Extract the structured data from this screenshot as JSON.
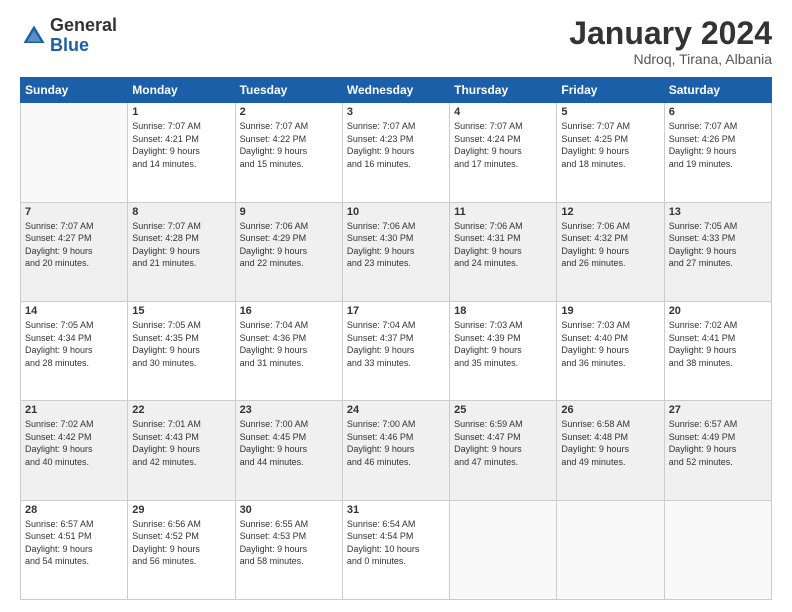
{
  "header": {
    "logo_general": "General",
    "logo_blue": "Blue",
    "month_title": "January 2024",
    "location": "Ndroq, Tirana, Albania"
  },
  "weekdays": [
    "Sunday",
    "Monday",
    "Tuesday",
    "Wednesday",
    "Thursday",
    "Friday",
    "Saturday"
  ],
  "rows": [
    {
      "shade": "white",
      "cells": [
        {
          "day": "",
          "info": ""
        },
        {
          "day": "1",
          "info": "Sunrise: 7:07 AM\nSunset: 4:21 PM\nDaylight: 9 hours\nand 14 minutes."
        },
        {
          "day": "2",
          "info": "Sunrise: 7:07 AM\nSunset: 4:22 PM\nDaylight: 9 hours\nand 15 minutes."
        },
        {
          "day": "3",
          "info": "Sunrise: 7:07 AM\nSunset: 4:23 PM\nDaylight: 9 hours\nand 16 minutes."
        },
        {
          "day": "4",
          "info": "Sunrise: 7:07 AM\nSunset: 4:24 PM\nDaylight: 9 hours\nand 17 minutes."
        },
        {
          "day": "5",
          "info": "Sunrise: 7:07 AM\nSunset: 4:25 PM\nDaylight: 9 hours\nand 18 minutes."
        },
        {
          "day": "6",
          "info": "Sunrise: 7:07 AM\nSunset: 4:26 PM\nDaylight: 9 hours\nand 19 minutes."
        }
      ]
    },
    {
      "shade": "shaded",
      "cells": [
        {
          "day": "7",
          "info": "Sunrise: 7:07 AM\nSunset: 4:27 PM\nDaylight: 9 hours\nand 20 minutes."
        },
        {
          "day": "8",
          "info": "Sunrise: 7:07 AM\nSunset: 4:28 PM\nDaylight: 9 hours\nand 21 minutes."
        },
        {
          "day": "9",
          "info": "Sunrise: 7:06 AM\nSunset: 4:29 PM\nDaylight: 9 hours\nand 22 minutes."
        },
        {
          "day": "10",
          "info": "Sunrise: 7:06 AM\nSunset: 4:30 PM\nDaylight: 9 hours\nand 23 minutes."
        },
        {
          "day": "11",
          "info": "Sunrise: 7:06 AM\nSunset: 4:31 PM\nDaylight: 9 hours\nand 24 minutes."
        },
        {
          "day": "12",
          "info": "Sunrise: 7:06 AM\nSunset: 4:32 PM\nDaylight: 9 hours\nand 26 minutes."
        },
        {
          "day": "13",
          "info": "Sunrise: 7:05 AM\nSunset: 4:33 PM\nDaylight: 9 hours\nand 27 minutes."
        }
      ]
    },
    {
      "shade": "white",
      "cells": [
        {
          "day": "14",
          "info": "Sunrise: 7:05 AM\nSunset: 4:34 PM\nDaylight: 9 hours\nand 28 minutes."
        },
        {
          "day": "15",
          "info": "Sunrise: 7:05 AM\nSunset: 4:35 PM\nDaylight: 9 hours\nand 30 minutes."
        },
        {
          "day": "16",
          "info": "Sunrise: 7:04 AM\nSunset: 4:36 PM\nDaylight: 9 hours\nand 31 minutes."
        },
        {
          "day": "17",
          "info": "Sunrise: 7:04 AM\nSunset: 4:37 PM\nDaylight: 9 hours\nand 33 minutes."
        },
        {
          "day": "18",
          "info": "Sunrise: 7:03 AM\nSunset: 4:39 PM\nDaylight: 9 hours\nand 35 minutes."
        },
        {
          "day": "19",
          "info": "Sunrise: 7:03 AM\nSunset: 4:40 PM\nDaylight: 9 hours\nand 36 minutes."
        },
        {
          "day": "20",
          "info": "Sunrise: 7:02 AM\nSunset: 4:41 PM\nDaylight: 9 hours\nand 38 minutes."
        }
      ]
    },
    {
      "shade": "shaded",
      "cells": [
        {
          "day": "21",
          "info": "Sunrise: 7:02 AM\nSunset: 4:42 PM\nDaylight: 9 hours\nand 40 minutes."
        },
        {
          "day": "22",
          "info": "Sunrise: 7:01 AM\nSunset: 4:43 PM\nDaylight: 9 hours\nand 42 minutes."
        },
        {
          "day": "23",
          "info": "Sunrise: 7:00 AM\nSunset: 4:45 PM\nDaylight: 9 hours\nand 44 minutes."
        },
        {
          "day": "24",
          "info": "Sunrise: 7:00 AM\nSunset: 4:46 PM\nDaylight: 9 hours\nand 46 minutes."
        },
        {
          "day": "25",
          "info": "Sunrise: 6:59 AM\nSunset: 4:47 PM\nDaylight: 9 hours\nand 47 minutes."
        },
        {
          "day": "26",
          "info": "Sunrise: 6:58 AM\nSunset: 4:48 PM\nDaylight: 9 hours\nand 49 minutes."
        },
        {
          "day": "27",
          "info": "Sunrise: 6:57 AM\nSunset: 4:49 PM\nDaylight: 9 hours\nand 52 minutes."
        }
      ]
    },
    {
      "shade": "white",
      "cells": [
        {
          "day": "28",
          "info": "Sunrise: 6:57 AM\nSunset: 4:51 PM\nDaylight: 9 hours\nand 54 minutes."
        },
        {
          "day": "29",
          "info": "Sunrise: 6:56 AM\nSunset: 4:52 PM\nDaylight: 9 hours\nand 56 minutes."
        },
        {
          "day": "30",
          "info": "Sunrise: 6:55 AM\nSunset: 4:53 PM\nDaylight: 9 hours\nand 58 minutes."
        },
        {
          "day": "31",
          "info": "Sunrise: 6:54 AM\nSunset: 4:54 PM\nDaylight: 10 hours\nand 0 minutes."
        },
        {
          "day": "",
          "info": ""
        },
        {
          "day": "",
          "info": ""
        },
        {
          "day": "",
          "info": ""
        }
      ]
    }
  ]
}
